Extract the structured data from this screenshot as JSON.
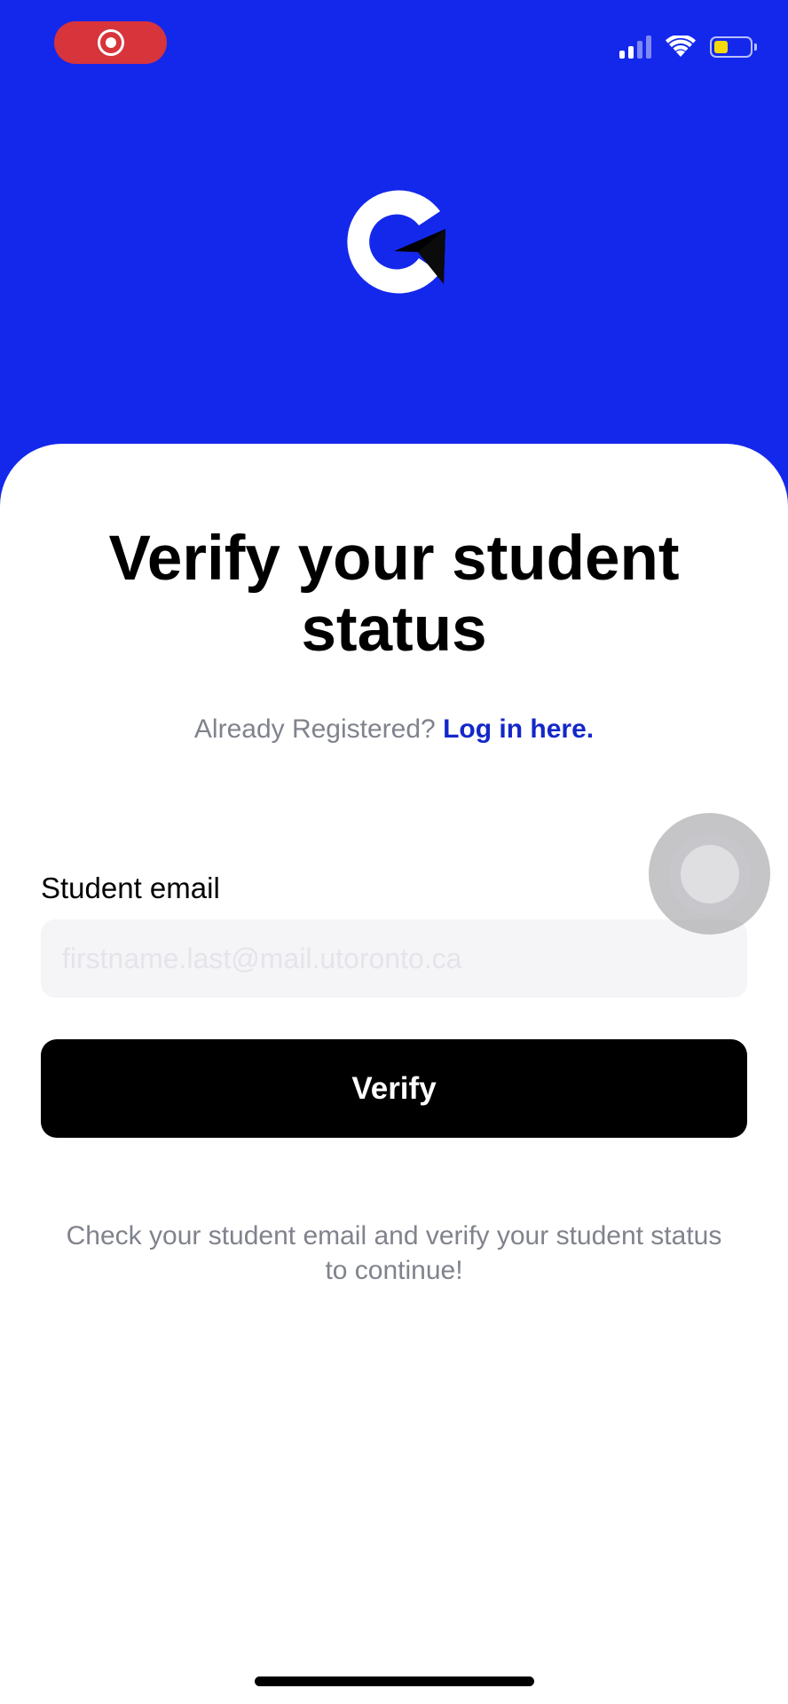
{
  "status_bar": {
    "recording_icon": "screen-recording-icon",
    "signal_icon": "cellular-signal-icon",
    "wifi_icon": "wifi-icon",
    "battery_icon": "battery-icon",
    "battery_level": 0.4
  },
  "header": {
    "logo_icon": "c-arrow-logo-icon",
    "background_color": "#1428ec"
  },
  "main": {
    "title": "Verify your student status",
    "login_prompt": "Already Registered?",
    "login_link": "Log in here.",
    "email_label": "Student email",
    "email_placeholder": "firstname.last@mail.utoronto.ca",
    "email_value": "",
    "verify_button": "Verify",
    "hint": "Check your student email and verify your student status to continue!"
  },
  "colors": {
    "accent": "#1428c8",
    "recording": "#d7343b",
    "battery": "#f5d90a"
  }
}
